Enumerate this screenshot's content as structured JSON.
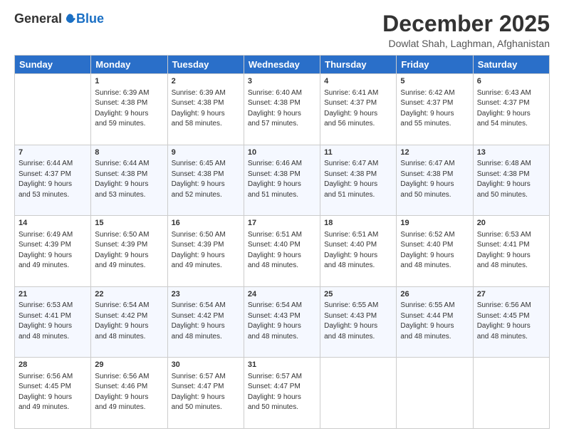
{
  "header": {
    "logo": {
      "general": "General",
      "blue": "Blue"
    },
    "title": "December 2025",
    "location": "Dowlat Shah, Laghman, Afghanistan"
  },
  "calendar": {
    "days_of_week": [
      "Sunday",
      "Monday",
      "Tuesday",
      "Wednesday",
      "Thursday",
      "Friday",
      "Saturday"
    ],
    "weeks": [
      [
        {
          "day": "",
          "info": ""
        },
        {
          "day": "1",
          "info": "Sunrise: 6:39 AM\nSunset: 4:38 PM\nDaylight: 9 hours\nand 59 minutes."
        },
        {
          "day": "2",
          "info": "Sunrise: 6:39 AM\nSunset: 4:38 PM\nDaylight: 9 hours\nand 58 minutes."
        },
        {
          "day": "3",
          "info": "Sunrise: 6:40 AM\nSunset: 4:38 PM\nDaylight: 9 hours\nand 57 minutes."
        },
        {
          "day": "4",
          "info": "Sunrise: 6:41 AM\nSunset: 4:37 PM\nDaylight: 9 hours\nand 56 minutes."
        },
        {
          "day": "5",
          "info": "Sunrise: 6:42 AM\nSunset: 4:37 PM\nDaylight: 9 hours\nand 55 minutes."
        },
        {
          "day": "6",
          "info": "Sunrise: 6:43 AM\nSunset: 4:37 PM\nDaylight: 9 hours\nand 54 minutes."
        }
      ],
      [
        {
          "day": "7",
          "info": "Sunrise: 6:44 AM\nSunset: 4:37 PM\nDaylight: 9 hours\nand 53 minutes."
        },
        {
          "day": "8",
          "info": "Sunrise: 6:44 AM\nSunset: 4:38 PM\nDaylight: 9 hours\nand 53 minutes."
        },
        {
          "day": "9",
          "info": "Sunrise: 6:45 AM\nSunset: 4:38 PM\nDaylight: 9 hours\nand 52 minutes."
        },
        {
          "day": "10",
          "info": "Sunrise: 6:46 AM\nSunset: 4:38 PM\nDaylight: 9 hours\nand 51 minutes."
        },
        {
          "day": "11",
          "info": "Sunrise: 6:47 AM\nSunset: 4:38 PM\nDaylight: 9 hours\nand 51 minutes."
        },
        {
          "day": "12",
          "info": "Sunrise: 6:47 AM\nSunset: 4:38 PM\nDaylight: 9 hours\nand 50 minutes."
        },
        {
          "day": "13",
          "info": "Sunrise: 6:48 AM\nSunset: 4:38 PM\nDaylight: 9 hours\nand 50 minutes."
        }
      ],
      [
        {
          "day": "14",
          "info": "Sunrise: 6:49 AM\nSunset: 4:39 PM\nDaylight: 9 hours\nand 49 minutes."
        },
        {
          "day": "15",
          "info": "Sunrise: 6:50 AM\nSunset: 4:39 PM\nDaylight: 9 hours\nand 49 minutes."
        },
        {
          "day": "16",
          "info": "Sunrise: 6:50 AM\nSunset: 4:39 PM\nDaylight: 9 hours\nand 49 minutes."
        },
        {
          "day": "17",
          "info": "Sunrise: 6:51 AM\nSunset: 4:40 PM\nDaylight: 9 hours\nand 48 minutes."
        },
        {
          "day": "18",
          "info": "Sunrise: 6:51 AM\nSunset: 4:40 PM\nDaylight: 9 hours\nand 48 minutes."
        },
        {
          "day": "19",
          "info": "Sunrise: 6:52 AM\nSunset: 4:40 PM\nDaylight: 9 hours\nand 48 minutes."
        },
        {
          "day": "20",
          "info": "Sunrise: 6:53 AM\nSunset: 4:41 PM\nDaylight: 9 hours\nand 48 minutes."
        }
      ],
      [
        {
          "day": "21",
          "info": "Sunrise: 6:53 AM\nSunset: 4:41 PM\nDaylight: 9 hours\nand 48 minutes."
        },
        {
          "day": "22",
          "info": "Sunrise: 6:54 AM\nSunset: 4:42 PM\nDaylight: 9 hours\nand 48 minutes."
        },
        {
          "day": "23",
          "info": "Sunrise: 6:54 AM\nSunset: 4:42 PM\nDaylight: 9 hours\nand 48 minutes."
        },
        {
          "day": "24",
          "info": "Sunrise: 6:54 AM\nSunset: 4:43 PM\nDaylight: 9 hours\nand 48 minutes."
        },
        {
          "day": "25",
          "info": "Sunrise: 6:55 AM\nSunset: 4:43 PM\nDaylight: 9 hours\nand 48 minutes."
        },
        {
          "day": "26",
          "info": "Sunrise: 6:55 AM\nSunset: 4:44 PM\nDaylight: 9 hours\nand 48 minutes."
        },
        {
          "day": "27",
          "info": "Sunrise: 6:56 AM\nSunset: 4:45 PM\nDaylight: 9 hours\nand 48 minutes."
        }
      ],
      [
        {
          "day": "28",
          "info": "Sunrise: 6:56 AM\nSunset: 4:45 PM\nDaylight: 9 hours\nand 49 minutes."
        },
        {
          "day": "29",
          "info": "Sunrise: 6:56 AM\nSunset: 4:46 PM\nDaylight: 9 hours\nand 49 minutes."
        },
        {
          "day": "30",
          "info": "Sunrise: 6:57 AM\nSunset: 4:47 PM\nDaylight: 9 hours\nand 50 minutes."
        },
        {
          "day": "31",
          "info": "Sunrise: 6:57 AM\nSunset: 4:47 PM\nDaylight: 9 hours\nand 50 minutes."
        },
        {
          "day": "",
          "info": ""
        },
        {
          "day": "",
          "info": ""
        },
        {
          "day": "",
          "info": ""
        }
      ]
    ]
  }
}
